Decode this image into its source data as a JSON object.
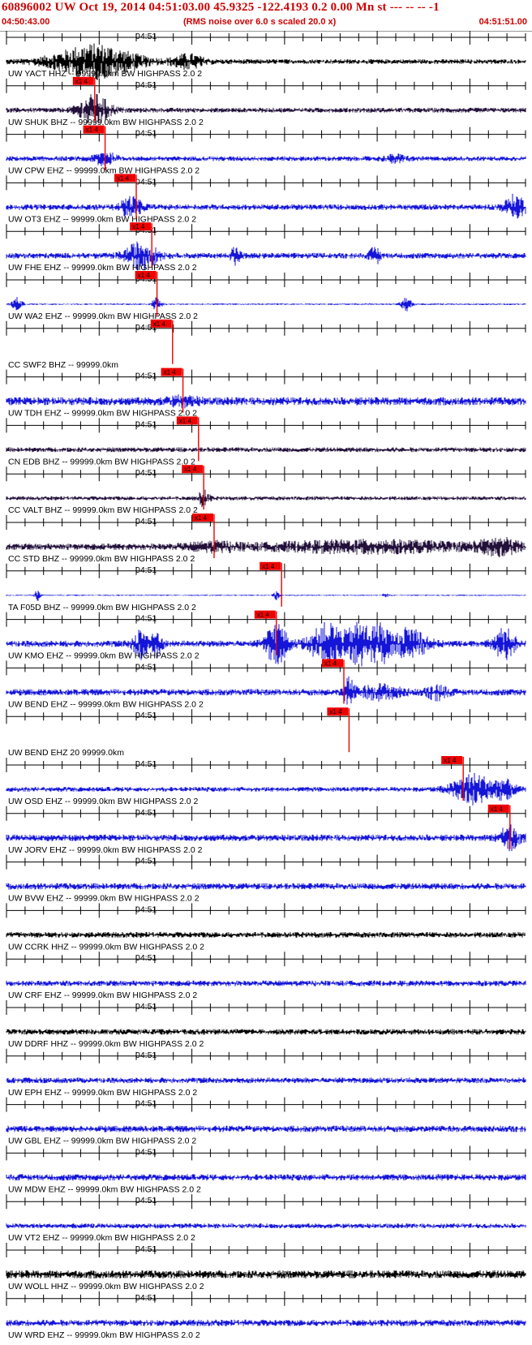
{
  "header": {
    "title": "60896002 UW Oct 19, 2014 04:51:03.00   45.9325 -122.4193  0.2 0.00 Mn st --- -- --  -1",
    "start_time": "04:50:43.00",
    "noise_note": "(RMS noise over 6.0 s scaled 20.0 x)",
    "end_time": "04:51:51.00"
  },
  "time_tick_label": "04:51",
  "pick_label": "x1 4",
  "colors": {
    "header_text": "#cc0000",
    "pick": "#ee0000",
    "axis": "#000000"
  },
  "traces": [
    {
      "label": "UW YACT HHZ -- 99999.0km BW  HIGHPASS  2.0  2",
      "color": "#000000",
      "amp": 3,
      "bursts": [
        [
          0.17,
          0.08,
          20
        ],
        [
          0.35,
          0.03,
          8
        ]
      ],
      "pick": null
    },
    {
      "label": "UW SHUK BHZ -- 99999.0km BW  HIGHPASS  2.0  2",
      "color": "#22103a",
      "amp": 3,
      "bursts": [
        [
          0.17,
          0.03,
          18
        ]
      ],
      "pick": 0.17
    },
    {
      "label": "UW CPW EHZ -- 99999.0km BW  HIGHPASS  2.0  2",
      "color": "#1515d8",
      "amp": 3,
      "bursts": [
        [
          0.19,
          0.02,
          8
        ],
        [
          0.75,
          0.02,
          4
        ]
      ],
      "pick": 0.19
    },
    {
      "label": "UW OT3 EHZ -- 99999.0km BW  HIGHPASS  2.0  2",
      "color": "#1515d8",
      "amp": 3.5,
      "bursts": [
        [
          0.24,
          0.02,
          12
        ],
        [
          0.98,
          0.02,
          14
        ]
      ],
      "pick": 0.25
    },
    {
      "label": "UW FHE EHZ -- 99999.0km BW  HIGHPASS  2.0  2",
      "color": "#1515d8",
      "amp": 3.5,
      "bursts": [
        [
          0.26,
          0.03,
          16
        ],
        [
          0.44,
          0.01,
          10
        ],
        [
          0.71,
          0.01,
          10
        ]
      ],
      "pick": 0.28
    },
    {
      "label": "UW WA2 EHZ -- 99999.0km BW  HIGHPASS  2.0  2",
      "color": "#1515d8",
      "amp": 1,
      "bursts": [
        [
          0.02,
          0.01,
          8
        ],
        [
          0.29,
          0.01,
          8
        ],
        [
          0.77,
          0.01,
          10
        ]
      ],
      "pick": 0.29
    },
    {
      "label": "CC SWF2 BHZ -- 99999.0km",
      "color": "#1515d8",
      "amp": 0,
      "bursts": [],
      "pick": 0.32
    },
    {
      "label": "UW TDH EHZ -- 99999.0km BW  HIGHPASS  2.0  2",
      "color": "#1515d8",
      "amp": 5,
      "bursts": [
        [
          0.34,
          0.03,
          4
        ]
      ],
      "pick": 0.34
    },
    {
      "label": "CN EDB BHZ -- 99999.0km BW  HIGHPASS  2.0  2",
      "color": "#22103a",
      "amp": 3,
      "bursts": [],
      "pick": 0.37
    },
    {
      "label": "CC VALT BHZ -- 99999.0km BW  HIGHPASS  2.0  2",
      "color": "#22103a",
      "amp": 2.5,
      "bursts": [
        [
          0.38,
          0.01,
          10
        ]
      ],
      "pick": 0.38
    },
    {
      "label": "CC STD BHZ -- 99999.0km BW  HIGHPASS  2.0  2",
      "color": "#22103a",
      "amp": 4,
      "bursts": [
        [
          0.4,
          0.05,
          4
        ],
        [
          0.7,
          0.2,
          6
        ],
        [
          0.95,
          0.04,
          8
        ]
      ],
      "pick": 0.4
    },
    {
      "label": "TA F05D BHZ -- 99999.0km BW  HIGHPASS  2.0  2",
      "color": "#1515d8",
      "amp": 0.8,
      "bursts": [
        [
          0.06,
          0.005,
          7
        ],
        [
          0.52,
          0.005,
          6
        ],
        [
          0.73,
          0.005,
          3
        ]
      ],
      "pick": 0.53
    },
    {
      "label": "UW KMO EHZ -- 99999.0km BW  HIGHPASS  2.0  2",
      "color": "#1515d8",
      "amp": 4,
      "bursts": [
        [
          0.26,
          0.015,
          18
        ],
        [
          0.29,
          0.01,
          14
        ],
        [
          0.52,
          0.02,
          26
        ],
        [
          0.62,
          0.035,
          24
        ],
        [
          0.68,
          0.02,
          26
        ],
        [
          0.72,
          0.02,
          24
        ],
        [
          0.78,
          0.03,
          20
        ],
        [
          0.96,
          0.02,
          18
        ]
      ],
      "pick": 0.52
    },
    {
      "label": "UW BEND EHZ -- 99999.0km BW  HIGHPASS  2.0  2",
      "color": "#1515d8",
      "amp": 4,
      "bursts": [
        [
          0.66,
          0.01,
          16
        ],
        [
          0.72,
          0.04,
          8
        ],
        [
          0.83,
          0.02,
          8
        ]
      ],
      "pick": 0.65
    },
    {
      "label": "UW BEND EHZ 20 99999.0km",
      "color": "#1515d8",
      "amp": 0,
      "bursts": [],
      "pick": 0.66
    },
    {
      "label": "UW OSD EHZ -- 99999.0km BW  HIGHPASS  2.0  2",
      "color": "#1515d8",
      "amp": 3,
      "bursts": [
        [
          0.9,
          0.04,
          18
        ],
        [
          0.96,
          0.02,
          10
        ]
      ],
      "pick": 0.88
    },
    {
      "label": "UW JORV EHZ -- 99999.0km BW  HIGHPASS  2.0  2",
      "color": "#1515d8",
      "amp": 4,
      "bursts": [
        [
          0.97,
          0.02,
          14
        ]
      ],
      "pick": 0.97
    },
    {
      "label": "UW BVW EHZ -- 99999.0km BW  HIGHPASS  2.0  2",
      "color": "#1515d8",
      "amp": 4,
      "bursts": [],
      "pick": null
    },
    {
      "label": "UW CCRK HHZ -- 99999.0km BW  HIGHPASS  2.0  2",
      "color": "#000000",
      "amp": 3.5,
      "bursts": [],
      "pick": null
    },
    {
      "label": "UW CRF EHZ -- 99999.0km BW  HIGHPASS  2.0  2",
      "color": "#1515d8",
      "amp": 3.5,
      "bursts": [],
      "pick": null
    },
    {
      "label": "UW DDRF HHZ -- 99999.0km BW  HIGHPASS  2.0  2",
      "color": "#000000",
      "amp": 3.5,
      "bursts": [],
      "pick": null
    },
    {
      "label": "UW EPH EHZ -- 99999.0km BW  HIGHPASS  2.0  2",
      "color": "#1515d8",
      "amp": 3.5,
      "bursts": [],
      "pick": null
    },
    {
      "label": "UW GBL EHZ -- 99999.0km BW  HIGHPASS  2.0  2",
      "color": "#1515d8",
      "amp": 4,
      "bursts": [],
      "pick": null
    },
    {
      "label": "UW MDW EHZ -- 99999.0km BW  HIGHPASS  2.0  2",
      "color": "#1515d8",
      "amp": 4,
      "bursts": [],
      "pick": null
    },
    {
      "label": "UW VT2 EHZ -- 99999.0km BW  HIGHPASS  2.0  2",
      "color": "#1515d8",
      "amp": 3,
      "bursts": [],
      "pick": null
    },
    {
      "label": "UW WOLL HHZ -- 99999.0km BW  HIGHPASS  2.0  2",
      "color": "#000000",
      "amp": 5,
      "bursts": [],
      "pick": null
    },
    {
      "label": "UW WRD EHZ -- 99999.0km BW  HIGHPASS  2.0  2",
      "color": "#1515d8",
      "amp": 4,
      "bursts": [],
      "pick": null
    }
  ]
}
